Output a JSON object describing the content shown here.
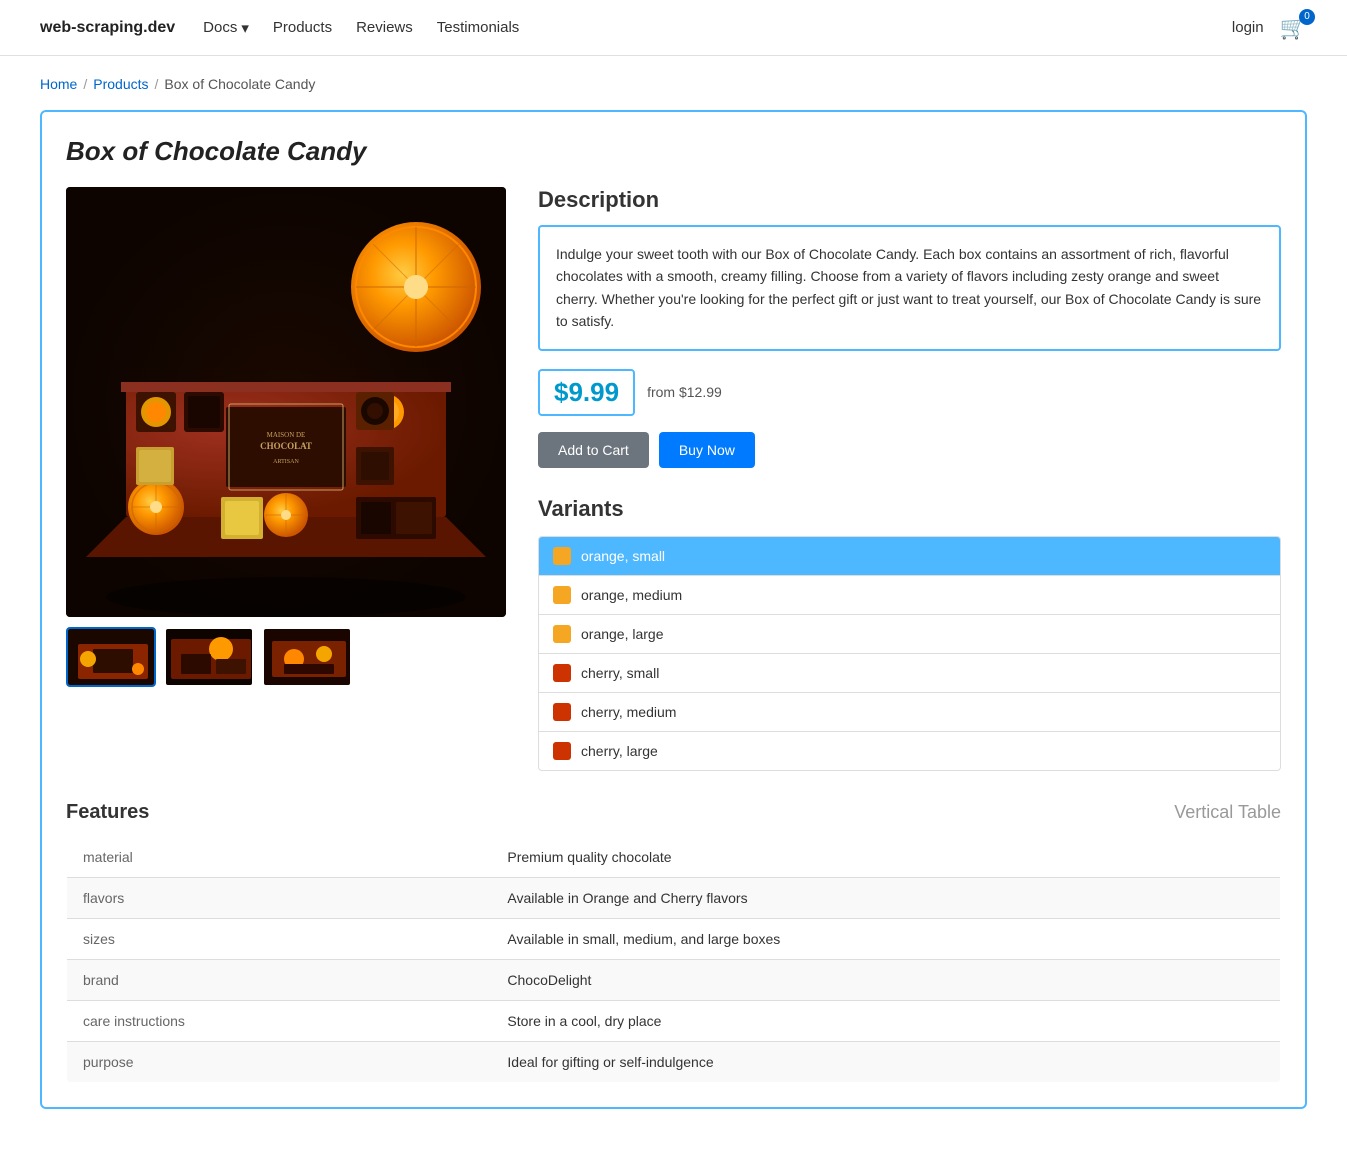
{
  "nav": {
    "brand": "web-scraping.dev",
    "links": [
      {
        "label": "Docs",
        "hasDropdown": true
      },
      {
        "label": "Products"
      },
      {
        "label": "Reviews"
      },
      {
        "label": "Testimonials"
      }
    ],
    "login": "login",
    "cart_count": "0"
  },
  "breadcrumb": {
    "home": "Home",
    "products": "Products",
    "current": "Box of Chocolate Candy"
  },
  "product": {
    "title": "Box of Chocolate Candy",
    "description": "Indulge your sweet tooth with our Box of Chocolate Candy. Each box contains an assortment of rich, flavorful chocolates with a smooth, creamy filling. Choose from a variety of flavors including zesty orange and sweet cherry. Whether you're looking for the perfect gift or just want to treat yourself, our Box of Chocolate Candy is sure to satisfy.",
    "price": "$9.99",
    "price_from": "from $12.99",
    "add_to_cart": "Add to Cart",
    "buy_now": "Buy Now",
    "variants_heading": "Variants",
    "variants": [
      {
        "label": "orange, small",
        "color": "orange",
        "active": true
      },
      {
        "label": "orange, medium",
        "color": "orange",
        "active": false
      },
      {
        "label": "orange, large",
        "color": "orange",
        "active": false
      },
      {
        "label": "cherry, small",
        "color": "cherry",
        "active": false
      },
      {
        "label": "cherry, medium",
        "color": "cherry",
        "active": false
      },
      {
        "label": "cherry, large",
        "color": "cherry",
        "active": false
      }
    ]
  },
  "features": {
    "heading": "Features",
    "table_type": "Vertical Table",
    "rows": [
      {
        "key": "material",
        "value": "Premium quality chocolate"
      },
      {
        "key": "flavors",
        "value": "Available in Orange and Cherry flavors"
      },
      {
        "key": "sizes",
        "value": "Available in small, medium, and large boxes"
      },
      {
        "key": "brand",
        "value": "ChocoDelight"
      },
      {
        "key": "care instructions",
        "value": "Store in a cool, dry place"
      },
      {
        "key": "purpose",
        "value": "Ideal for gifting or self-indulgence"
      }
    ]
  }
}
